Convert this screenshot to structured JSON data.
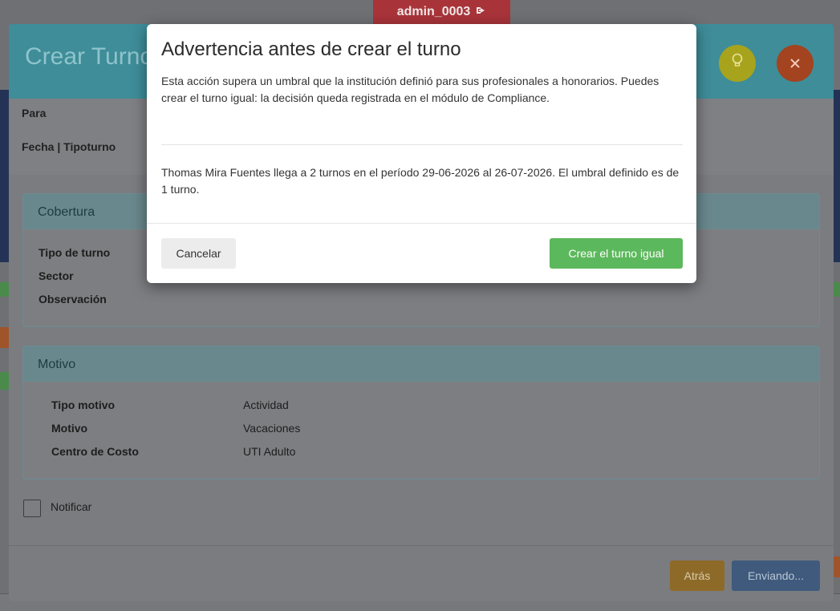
{
  "top_bar": {
    "username": "admin_0003",
    "logout_icon": "logout-icon"
  },
  "modal": {
    "title": "Crear Turno",
    "bulb_icon": "lightbulb-icon",
    "close_icon": "close-icon",
    "info": {
      "para_label": "Para",
      "fecha_label": "Fecha | Tipoturno"
    },
    "cobertura": {
      "title": "Cobertura",
      "rows": [
        {
          "label": "Tipo de turno"
        },
        {
          "label": "Sector"
        },
        {
          "label": "Observación"
        }
      ]
    },
    "motivo": {
      "title": "Motivo",
      "rows": [
        {
          "label": "Tipo motivo",
          "value": "Actividad"
        },
        {
          "label": "Motivo",
          "value": "Vacaciones"
        },
        {
          "label": "Centro de Costo",
          "value": "UTI Adulto"
        }
      ]
    },
    "notificar_label": "Notificar",
    "notificar_checked": false,
    "footer": {
      "back_label": "Atrás",
      "submit_label": "Enviando..."
    }
  },
  "warning": {
    "title": "Advertencia antes de crear el turno",
    "body1": "Esta acción supera un umbral que la institución definió para sus profesionales a honorarios. Puedes crear el turno igual: la decisión queda registrada en el módulo de Compliance.",
    "body2": "Thomas Mira Fuentes llega a 2 turnos en el período 29-06-2026 al 26-07-2026. El umbral definido es de 1 turno.",
    "cancel_label": "Cancelar",
    "confirm_label": "Crear el turno igual"
  },
  "colors": {
    "confirm_green": "#5cb85c",
    "header_teal": "#3e8d99",
    "user_badge_red": "#a8343a"
  }
}
